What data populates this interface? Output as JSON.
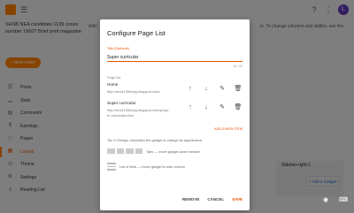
{
  "background": {
    "blog_name": "SHSB NEA candidate 1139 conce number 16607 Brief print magazine",
    "new_post_label": "+ NEW POST",
    "header_info_left": "Add",
    "header_info_right": "in. To change columns and widths, use the",
    "nav": [
      {
        "icon": "☰",
        "icon_name": "posts-icon",
        "label": "Posts"
      },
      {
        "icon": "▁",
        "icon_name": "stats-icon",
        "label": "Stats"
      },
      {
        "icon": "▤",
        "icon_name": "comments-icon",
        "label": "Comments"
      },
      {
        "icon": "$",
        "icon_name": "earnings-icon",
        "label": "Earnings"
      },
      {
        "icon": "□",
        "icon_name": "pages-icon",
        "label": "Pages"
      },
      {
        "icon": "▦",
        "icon_name": "layout-icon",
        "label": "Layout"
      },
      {
        "icon": "⊙",
        "icon_name": "theme-icon",
        "label": "Theme"
      },
      {
        "icon": "⚙",
        "icon_name": "settings-icon",
        "label": "Settings"
      },
      {
        "icon": "≡",
        "icon_name": "reading-list-icon",
        "label": "Reading List"
      }
    ],
    "active_nav_index": 5,
    "sidebar_right_label": "Sidebar-right-1",
    "add_gadget_label": "+ Add a Gadget",
    "avatar_letter": "L",
    "accent_color": "#f57c00"
  },
  "dialog": {
    "title": "Configure Page List",
    "title_field_label": "Title (Optional)",
    "title_field_value": "Super curricular",
    "title_field_count": "16 / 50",
    "list_label": "Page list",
    "links": [
      {
        "name": "Home",
        "url": "http://mrs1139shsg.blogspot.com/"
      },
      {
        "name": "Super curricular",
        "url": "http://mrs1139shsg.blogspot.com/p/super-curricular.html"
      }
    ],
    "add_item_label": "ADD A NEW ITEM",
    "tip_text": "Tip: In Design, reposition the gadget to change its appearance.",
    "tabs_tip": "Tabs — move gadget under header",
    "links_tip": "List of links — move gadget to side column",
    "remove_label": "REMOVE",
    "cancel_label": "CANCEL",
    "save_label": "SAVE"
  }
}
